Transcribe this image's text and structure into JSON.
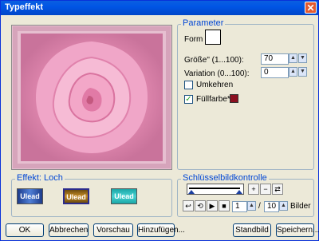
{
  "window": {
    "title": "Typeffekt"
  },
  "parameter": {
    "group_label": "Parameter",
    "form_label": "Form",
    "size_label": "Größe\" (1...100):",
    "size_value": "70",
    "variation_label": "Variation (0...100):",
    "variation_value": "0",
    "reverse_label": "Umkehren",
    "reverse_checked": false,
    "fill_label": "Füllfarbe*:",
    "fill_checked": true,
    "fill_color": "#8b1020"
  },
  "effect": {
    "group_label": "Effekt: Loch",
    "thumbnails": [
      "Ulead",
      "Ulead",
      "Ulead"
    ]
  },
  "keyframe": {
    "group_label": "Schlüsselbildkontrolle",
    "frame_value": "1",
    "slash": "/",
    "frame_total": "10",
    "frames_label": "Bilder"
  },
  "buttons": {
    "ok": "OK",
    "cancel": "Abbrechen",
    "preview": "Vorschau",
    "add": "Hinzufügen...",
    "default": "Standbild",
    "save": "Speichern..."
  },
  "icons": {
    "close": "close-icon",
    "spin_up": "spin-up-icon",
    "spin_down": "spin-down-icon"
  }
}
